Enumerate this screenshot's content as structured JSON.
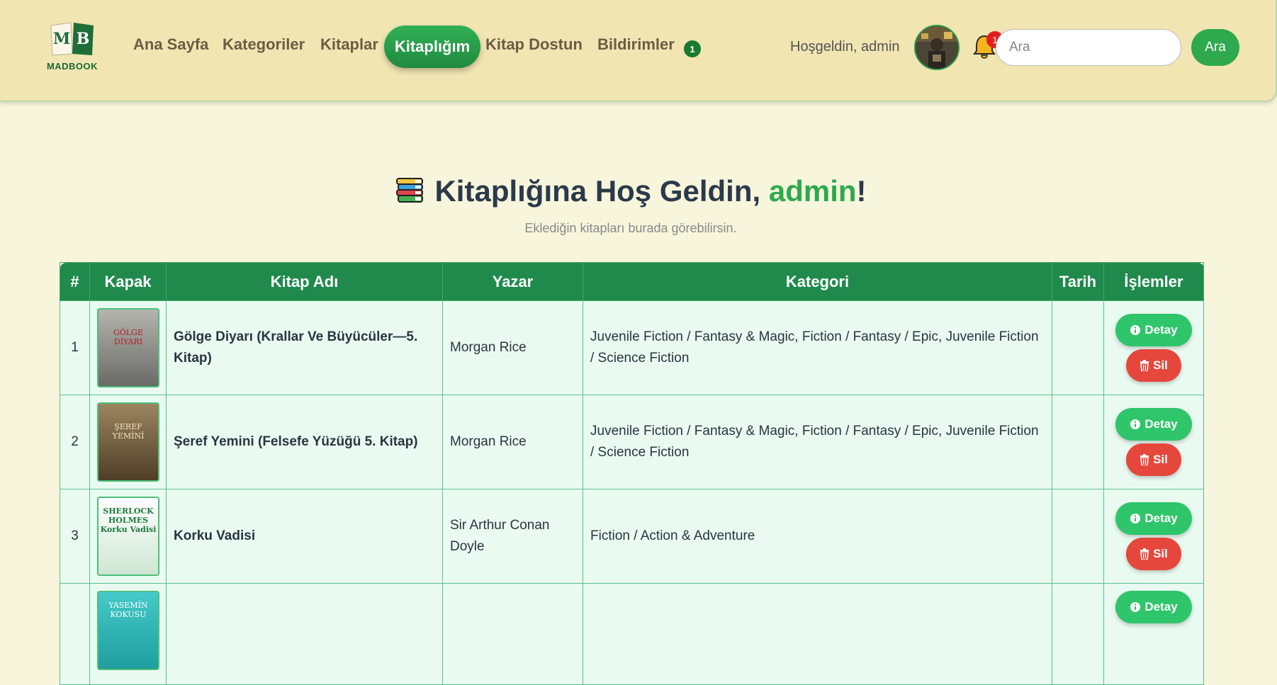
{
  "brand": {
    "name": "MADBOOK",
    "mark": "MB"
  },
  "nav": {
    "items": [
      "Ana Sayfa",
      "Kategoriler",
      "Kitaplar"
    ],
    "active": "Kitaplığım",
    "after": [
      "Kitap Dostun",
      "Bildirimler"
    ],
    "notification_count": "1"
  },
  "user": {
    "greeting": "Hoşgeldin, admin",
    "bell_count": "1"
  },
  "search": {
    "placeholder": "Ara",
    "button": "Ara"
  },
  "page": {
    "title_prefix": "Kitaplığına Hoş Geldin, ",
    "title_name": "admin",
    "title_suffix": "!",
    "subtitle": "Eklediğin kitapları burada görebilirsin."
  },
  "table": {
    "headers": [
      "#",
      "Kapak",
      "Kitap Adı",
      "Yazar",
      "Kategori",
      "Tarih",
      "İşlemler"
    ],
    "detail_label": "Detay",
    "delete_label": "Sil",
    "rows": [
      {
        "num": "1",
        "title": "Gölge Diyarı (Krallar Ve Büyücüler—5. Kitap)",
        "author": "Morgan Rice",
        "category": "Juvenile Fiction / Fantasy & Magic, Fiction / Fantasy / Epic, Juvenile Fiction / Science Fiction",
        "date": "",
        "cover": {
          "text": "GÖLGE DİYARI",
          "bg": "#8a8a88",
          "fg": "#b21e1e"
        }
      },
      {
        "num": "2",
        "title": "Şeref Yemini (Felsefe Yüzüğü 5. Kitap)",
        "author": "Morgan Rice",
        "category": "Juvenile Fiction / Fantasy & Magic, Fiction / Fantasy / Epic, Juvenile Fiction / Science Fiction",
        "date": "",
        "cover": {
          "text": "ŞEREF YEMİNİ",
          "bg": "#6e5a3a",
          "fg": "#f3e4c4"
        }
      },
      {
        "num": "3",
        "title": "Korku Vadisi",
        "author": "Sir Arthur Conan Doyle",
        "category": "Fiction / Action & Adventure",
        "date": "",
        "cover": {
          "text": "SHERLOCK HOLMES Korku Vadisi",
          "bg": "#f4f8f2",
          "fg": "#1b7a3a"
        }
      },
      {
        "num": "",
        "title": "",
        "author": "",
        "category": "",
        "date": "",
        "cover": {
          "text": "YASEMİN KOKUSU",
          "bg": "#2bb6b6",
          "fg": "#ffffff"
        }
      }
    ]
  },
  "colors": {
    "accent": "#2ea94d",
    "header": "#1f8a4c",
    "delete": "#e5473c",
    "navbar": "#f1e5b2"
  }
}
